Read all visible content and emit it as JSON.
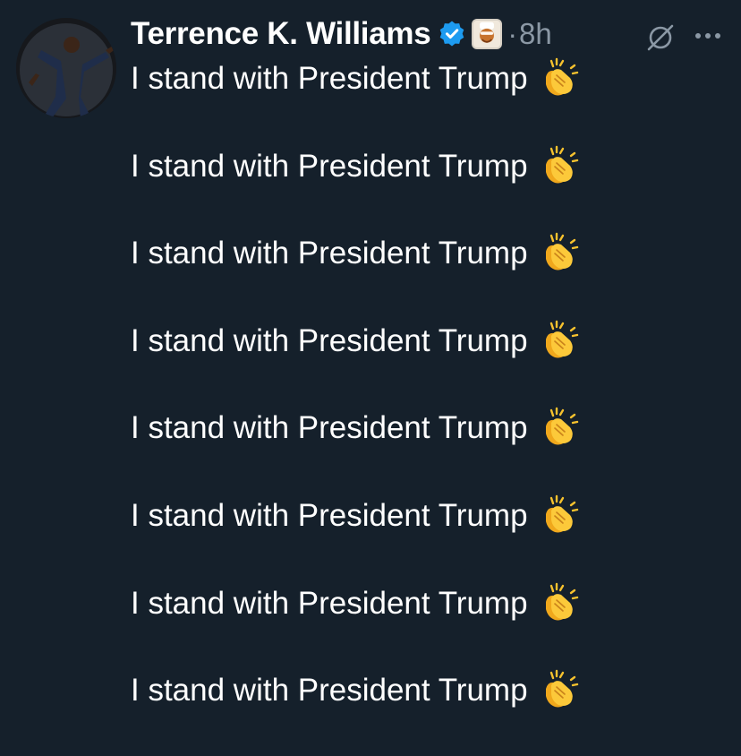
{
  "tweet": {
    "author": {
      "display_name": "Terrence K. Williams",
      "avatar_icon": "person-avatar",
      "verified_icon": "verified-badge-icon",
      "affiliate_icon": "affiliate-badge-icon"
    },
    "separator": "·",
    "time": "8h",
    "actions": {
      "grok_icon": "grok-icon",
      "more_icon": "more-dots-icon"
    },
    "lines": [
      "I stand with President Trump",
      "I stand with President Trump",
      "I stand with President Trump",
      "I stand with President Trump",
      "I stand with President Trump",
      "I stand with President Trump",
      "I stand with President Trump",
      "I stand with President Trump"
    ],
    "line_emoji": "clapping-hands-icon"
  },
  "colors": {
    "background": "#15202b",
    "text": "#ffffff",
    "muted": "#8b98a5",
    "verified": "#1d9bf0",
    "clap": "#f7c22e"
  }
}
